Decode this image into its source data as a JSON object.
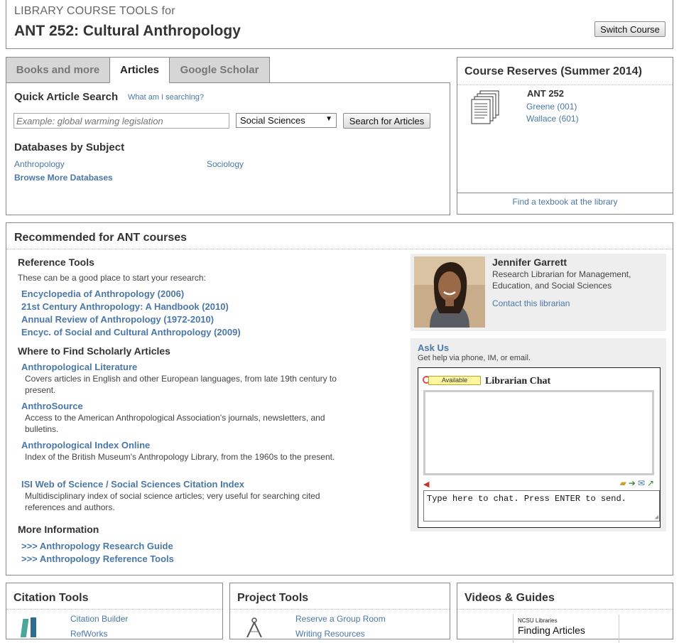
{
  "header": {
    "subtitle": "LIBRARY COURSE TOOLS for",
    "course_title": "ANT 252: Cultural Anthropology",
    "switch_label": "Switch Course"
  },
  "tabs": [
    {
      "label": "Books and more",
      "active": false
    },
    {
      "label": "Articles",
      "active": true
    },
    {
      "label": "Google Scholar",
      "active": false
    }
  ],
  "search": {
    "title": "Quick Article Search",
    "help_link": "What am I searching?",
    "placeholder": "Example: global warming legislation",
    "subject": "Social Sciences",
    "button": "Search for Articles",
    "db_title": "Databases by Subject",
    "databases": [
      "Anthropology",
      "Sociology"
    ],
    "browse_more": "Browse More Databases"
  },
  "reserves": {
    "title": "Course Reserves (Summer 2014)",
    "course_code": "ANT 252",
    "sections": [
      "Greene (001)",
      "Wallace (601)"
    ],
    "find_textbook": "Find a texbook at the library"
  },
  "recommended": {
    "title": "Recommended for ANT courses",
    "reference": {
      "heading": "Reference Tools",
      "intro": "These can be a good place to start your research:",
      "links": [
        "Encyclopedia of Anthropology (2006)",
        "21st Century Anthropology: A Handbook (2010)",
        "Annual Review of Anthropology (1972-2010)",
        "Encyc. of Social and Cultural Anthropology (2009)"
      ]
    },
    "scholarly": {
      "heading": "Where to Find Scholarly Articles",
      "items": [
        {
          "name": "Anthropological Literature",
          "desc": "Covers articles in English and other European languages, from late 19th century to present."
        },
        {
          "name": "AnthroSource",
          "desc": "Access to the American Anthropological Association's journals, newsletters, and bulletins."
        },
        {
          "name": "Anthropological Index Online",
          "desc": "Index of the British Museum's Anthropology Library, from the 1960s to the present."
        },
        {
          "name": "ISI Web of Science / Social Sciences Citation Index",
          "desc": "Multidisciplinary index of social science articles; very useful for searching cited references and authors."
        }
      ]
    },
    "more": {
      "heading": "More Information",
      "links": [
        ">>> Anthropology Research Guide",
        ">>> Anthropology Reference Tools"
      ]
    }
  },
  "librarian": {
    "name": "Jennifer Garrett",
    "role": "Research Librarian for Management, Education, and Social Sciences",
    "contact": "Contact this librarian"
  },
  "ask": {
    "title": "Ask Us",
    "subtitle": "Get help via phone, IM, or email.",
    "chat_status": "Available",
    "chat_title": "Librarian Chat",
    "chat_input": "Type here to chat. Press ENTER to send."
  },
  "bottom": {
    "citation": {
      "title": "Citation Tools",
      "links": [
        "Citation Builder",
        "RefWorks"
      ]
    },
    "project": {
      "title": "Project Tools",
      "links": [
        "Reserve a Group Room",
        "Writing Resources"
      ]
    },
    "videos": {
      "title": "Videos & Guides",
      "thumb_line1": "NCSU Libraries",
      "thumb_line2": "Finding Articles"
    }
  },
  "colors": {
    "link": "#4a78a8",
    "tab_inactive": "#d6d6d6",
    "panel_gray": "#eeeeee"
  }
}
